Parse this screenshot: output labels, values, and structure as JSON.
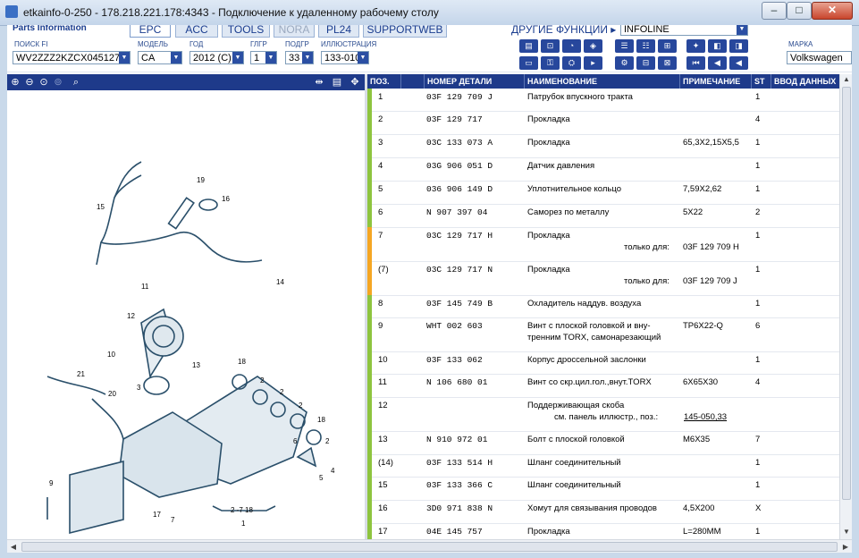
{
  "window": {
    "title": "etkainfo-0-250 - 178.218.221.178:4343 - Подключение к удаленному рабочему столу",
    "min_glyph": "–",
    "max_glyph": "□",
    "close_glyph": "✕"
  },
  "app": {
    "brand": "Parts Information",
    "tabs": [
      {
        "label": "EPC",
        "state": "active"
      },
      {
        "label": "ACC",
        "state": "normal"
      },
      {
        "label": "TOOLS",
        "state": "normal"
      },
      {
        "label": "NORA",
        "state": "disabled"
      },
      {
        "label": "PL24",
        "state": "normal"
      },
      {
        "label": "SUPPORTWEB",
        "state": "normal"
      }
    ],
    "other_functions": "ДРУГИЕ ФУНКЦИИ ▸",
    "other_functions_value": "INFOLINE"
  },
  "search": {
    "vin_label": "ПОИСК FI",
    "vin_value": "WV2ZZZ2KZCX045127",
    "model_label": "МОДЕЛЬ",
    "model_value": "CA",
    "year_label": "ГОД",
    "year_value": "2012 (C)",
    "hg_label": "ГЛГР",
    "hg_value": "1",
    "ug_label": "ПОДГР",
    "ug_value": "33",
    "illus_label": "ИЛЛЮСТРАЦИЯ",
    "illus_value": "133-010",
    "brand_label": "МАРКА",
    "brand_value": "Volkswagen"
  },
  "table": {
    "headers": [
      "ПОЗ.",
      "НОМЕР ДЕТАЛИ",
      "НАИМЕНОВАНИЕ",
      "ПРИМЕЧАНИЕ",
      "ST",
      "ВВОД ДАННЫХ"
    ],
    "rows": [
      {
        "pos": "1",
        "part": "03F 129 709 J",
        "name": "Патрубок впускного тракта",
        "note": "",
        "qty": "1",
        "mark": "green"
      },
      {
        "pos": "2",
        "part": "03F 129 717",
        "name": "Прокладка",
        "note": "",
        "qty": "4",
        "mark": "green"
      },
      {
        "pos": "3",
        "part": "03C 133 073 A",
        "name": "Прокладка",
        "note": "65,3X2,15X5,5",
        "qty": "1",
        "mark": "green"
      },
      {
        "pos": "4",
        "part": "03G 906 051 D",
        "name": "Датчик давления",
        "note": "",
        "qty": "1",
        "mark": "green"
      },
      {
        "pos": "5",
        "part": "036 906 149 D",
        "name": "Уплотнительное кольцо",
        "note": "7,59X2,62",
        "qty": "1",
        "mark": "green"
      },
      {
        "pos": "6",
        "part": "N  907 397 04",
        "name": "Саморез по металлу",
        "note": "5X22",
        "qty": "2",
        "mark": "green"
      },
      {
        "pos": "7",
        "part": "03C 129 717 H",
        "name": "Прокладка",
        "note": "",
        "qty": "1",
        "mark": "orange",
        "only_label": "только для:",
        "only_value": "03F 129 709 H"
      },
      {
        "pos": "(7)",
        "part": "03C 129 717 N",
        "name": "Прокладка",
        "note": "",
        "qty": "1",
        "mark": "orange",
        "only_label": "только для:",
        "only_value": "03F 129 709 J"
      },
      {
        "pos": "8",
        "part": "03F 145 749 B",
        "name": "Охладитель наддув. воздуха",
        "note": "",
        "qty": "1",
        "mark": "green"
      },
      {
        "pos": "9",
        "part": "WHT 002 603",
        "name": "Винт с плоской головкой и вну-",
        "name2": "тренним TORX, самонарезающий",
        "note": "TP6X22-Q",
        "qty": "6",
        "mark": "green"
      },
      {
        "pos": "10",
        "part": "03F 133 062",
        "name": "Корпус дроссельной заслонки",
        "note": "",
        "qty": "1",
        "mark": "green"
      },
      {
        "pos": "11",
        "part": "N  106 680 01",
        "name": "Винт со скр.цил.гол.,внут.TORX",
        "note": "6X65X30",
        "qty": "4",
        "mark": "green"
      },
      {
        "pos": "12",
        "part": "",
        "name": "Поддерживающая скоба",
        "note": "",
        "qty": "",
        "mark": "green",
        "see_label": "см. панель иллюстр., поз.:",
        "see_value": "145-050,33"
      },
      {
        "pos": "13",
        "part": "N  910 972 01",
        "name": "Болт с плоской головкой",
        "note": "M6X35",
        "qty": "7",
        "mark": "green"
      },
      {
        "pos": "(14)",
        "part": "03F 133 514 H",
        "name": "Шланг соединительный",
        "note": "",
        "qty": "1",
        "mark": "green"
      },
      {
        "pos": "15",
        "part": "03F 133 366 C",
        "name": "Шланг соединительный",
        "note": "",
        "qty": "1",
        "mark": "green"
      },
      {
        "pos": "16",
        "part": "3D0 971 838 N",
        "name": "Хомут для связывания проводов",
        "note": "4,5X200",
        "qty": "X",
        "mark": "green"
      },
      {
        "pos": "17",
        "part": "04E 145 757",
        "name": "Прокладка",
        "note": "L=280MM",
        "qty": "1",
        "mark": "green"
      }
    ]
  },
  "illustration": {
    "callouts": [
      "1",
      "2",
      "2",
      "2",
      "2",
      "3",
      "4",
      "5",
      "6",
      "7",
      "8",
      "9",
      "10",
      "11",
      "12",
      "13",
      "14",
      "15",
      "16",
      "17",
      "18",
      "18",
      "19",
      "20",
      "21"
    ],
    "bracket_label": "2 -7  18"
  },
  "colors": {
    "accent": "#1e3a8a",
    "marker_green": "#8ec43f",
    "marker_orange": "#f5a623"
  }
}
